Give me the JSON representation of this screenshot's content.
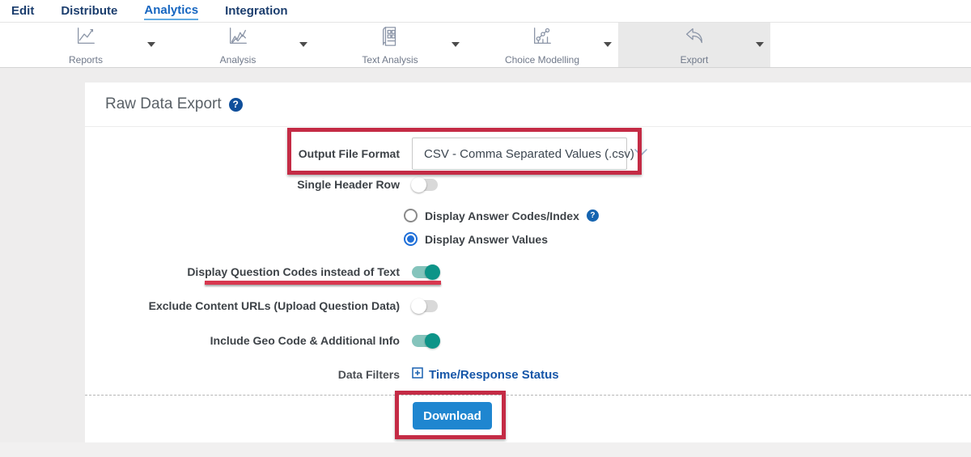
{
  "nav": {
    "items": [
      {
        "label": "Edit",
        "active": false
      },
      {
        "label": "Distribute",
        "active": false
      },
      {
        "label": "Analytics",
        "active": true
      },
      {
        "label": "Integration",
        "active": false
      }
    ]
  },
  "toolbar": {
    "items": [
      {
        "label": "Reports",
        "icon": "line-chart-icon",
        "active": false
      },
      {
        "label": "Analysis",
        "icon": "multi-line-chart-icon",
        "active": false
      },
      {
        "label": "Text Analysis",
        "icon": "report-document-icon",
        "active": false
      },
      {
        "label": "Choice Modelling",
        "icon": "scatter-chart-icon",
        "active": false
      },
      {
        "label": "Export",
        "icon": "export-arrow-icon",
        "active": true
      }
    ]
  },
  "page": {
    "title": "Raw Data Export",
    "help_icon": "?"
  },
  "form": {
    "output_format": {
      "label": "Output File Format",
      "value": "CSV - Comma Separated Values (.csv)"
    },
    "single_header_row": {
      "label": "Single Header Row",
      "state": "off"
    },
    "answer_display": {
      "options": [
        {
          "label": "Display Answer Codes/Index",
          "selected": false,
          "has_help": true,
          "help_icon": "?"
        },
        {
          "label": "Display Answer Values",
          "selected": true
        }
      ]
    },
    "question_codes": {
      "label": "Display Question Codes instead of Text",
      "state": "on"
    },
    "exclude_content_urls": {
      "label": "Exclude Content URLs (Upload Question Data)",
      "state": "off"
    },
    "include_geo": {
      "label": "Include Geo Code & Additional Info",
      "state": "on"
    },
    "data_filters": {
      "label": "Data Filters",
      "link_label": "Time/Response Status"
    },
    "download_label": "Download"
  },
  "colors": {
    "annotation_red": "#c42b45",
    "toggle_on_teal": "#0d9488",
    "download_blue": "#1f86d0",
    "active_nav_blue": "#1565c0",
    "nav_navy": "#1c3e6e",
    "link_blue": "#1656a8"
  }
}
